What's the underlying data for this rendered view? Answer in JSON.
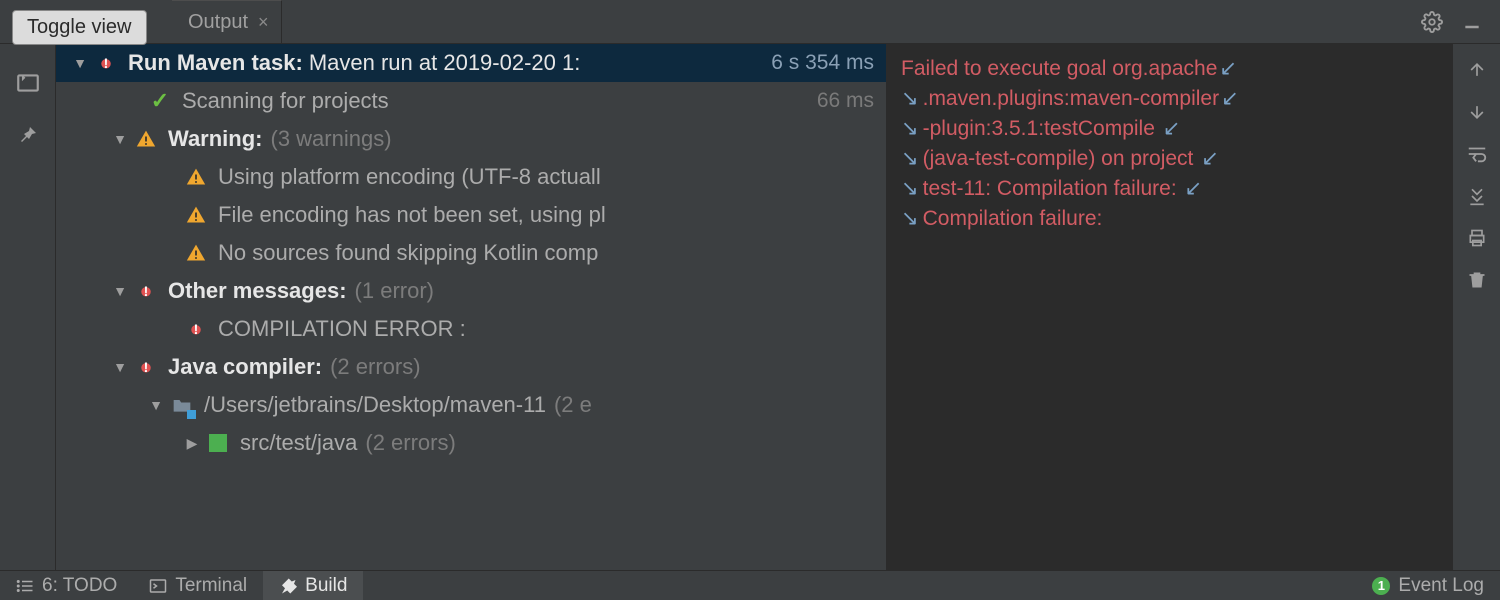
{
  "tooltip": "Toggle view",
  "tab": {
    "label": "Output"
  },
  "tree": {
    "root": {
      "label": "Run Maven task:",
      "detail": "Maven run at 2019-02-20 1:",
      "time": "6 s 354 ms"
    },
    "scan": {
      "label": "Scanning for projects",
      "time": "66 ms"
    },
    "warn": {
      "label": "Warning:",
      "count": "(3 warnings)"
    },
    "w1": "Using platform encoding (UTF-8 actuall",
    "w2": "File encoding has not been set, using pl",
    "w3": "No sources found skipping Kotlin comp",
    "other": {
      "label": "Other messages:",
      "count": "(1 error)"
    },
    "o1": "COMPILATION ERROR :",
    "javac": {
      "label": "Java compiler:",
      "count": "(2 errors)"
    },
    "path": {
      "label": "/Users/jetbrains/Desktop/maven-11",
      "count": "(2 e"
    },
    "src": {
      "label": "src/test/java",
      "count": "(2 errors)"
    }
  },
  "console": {
    "l1": "Failed to execute goal org.apache",
    "l2": ".maven.plugins:maven-compiler",
    "l3": "-plugin:3.5.1:testCompile ",
    "l4": "(java-test-compile) on project ",
    "l5": "test-11: Compilation failure: ",
    "l6": "Compilation failure:"
  },
  "status": {
    "todo": "6: TODO",
    "terminal": "Terminal",
    "build": "Build",
    "eventlog": "Event Log",
    "eventcount": "1"
  }
}
